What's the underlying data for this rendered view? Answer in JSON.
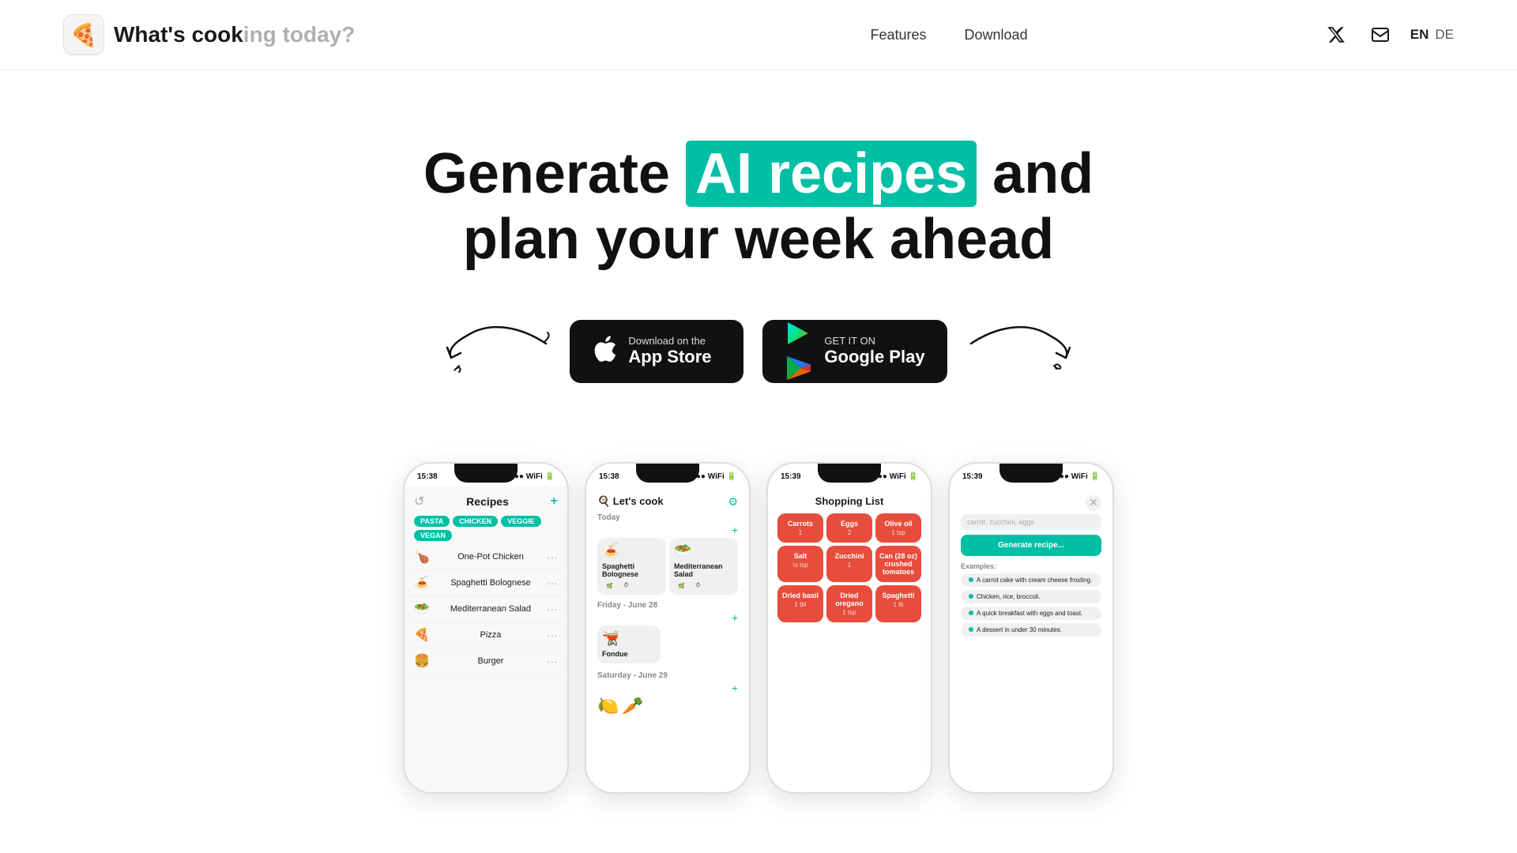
{
  "header": {
    "logo_icon": "🍕",
    "logo_text_black": "What's cook",
    "logo_text_gray": "ing today?",
    "nav_items": [
      {
        "label": "Features",
        "href": "#features"
      },
      {
        "label": "Download",
        "href": "#download"
      }
    ],
    "twitter_icon": "𝕏",
    "mail_icon": "✉",
    "lang_options": [
      {
        "code": "EN",
        "active": true
      },
      {
        "code": "DE",
        "active": false
      }
    ]
  },
  "hero": {
    "headline_before": "Generate ",
    "headline_highlight": "AI recipes",
    "headline_after": " and",
    "headline_line2": "plan your week ahead",
    "app_store_label_sub": "Download on the",
    "app_store_label_main": "App Store",
    "google_play_label_sub": "GET IT ON",
    "google_play_label_main": "Google Play"
  },
  "phones": {
    "phone1": {
      "time": "15:38",
      "header": "Recipes",
      "tags": [
        "PASTA",
        "CHICKEN",
        "VEGGIE",
        "VEGAN"
      ],
      "items": [
        {
          "icon": "🍗",
          "name": "One-Pot Chicken"
        },
        {
          "icon": "🍝",
          "name": "Spaghetti Bolognese"
        },
        {
          "icon": "🥗",
          "name": "Mediterranean Salad"
        },
        {
          "icon": "🍕",
          "name": "Pizza"
        },
        {
          "icon": "🍔",
          "name": "Burger"
        }
      ]
    },
    "phone2": {
      "time": "15:38",
      "header": "🍳 Let's cook",
      "section_today": "Today",
      "meals_today": [
        {
          "icon": "🍝",
          "name": "Spaghetti Bolognese"
        },
        {
          "icon": "🥗",
          "name": "Mediterranean Salad"
        }
      ],
      "section_friday": "Friday - June 28",
      "meal_friday": {
        "icon": "🫕",
        "name": "Fondue"
      },
      "section_saturday": "Saturday - June 29"
    },
    "phone3": {
      "time": "15:39",
      "header": "Shopping List",
      "items": [
        {
          "name": "Carrots",
          "qty": "1"
        },
        {
          "name": "Eggs",
          "qty": "2"
        },
        {
          "name": "Olive oil",
          "qty": "1 tsp"
        },
        {
          "name": "Salt",
          "qty": "½ tsp"
        },
        {
          "name": "Zucchini",
          "qty": "1"
        },
        {
          "name": "Can (28 oz) crushed tomatoes",
          "qty": ""
        },
        {
          "name": "Dried basil",
          "qty": "1 tbl"
        },
        {
          "name": "Dried oregano",
          "qty": "1 tsp"
        },
        {
          "name": "Spaghetti",
          "qty": "1 lb"
        }
      ]
    },
    "phone4": {
      "time": "15:39",
      "search_placeholder": "carrot, zucchini, eggs",
      "generate_btn": "Generate recipe...",
      "examples_title": "Examples:",
      "examples": [
        "A carrot cake with cream cheese frosting.",
        "Chicken, rice, broccoli.",
        "A quick breakfast with eggs and toast.",
        "A dessert in under 30 minutes."
      ]
    }
  }
}
